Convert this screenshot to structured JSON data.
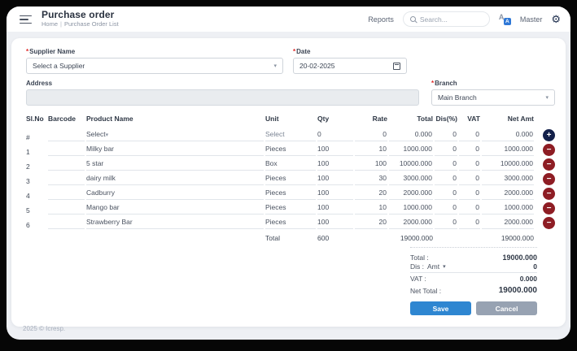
{
  "header": {
    "title": "Purchase order",
    "breadcrumb": {
      "home": "Home",
      "separator": "|",
      "current": "Purchase Order List"
    },
    "nav": {
      "reports": "Reports",
      "master": "Master"
    },
    "search": {
      "placeholder": "Search..."
    }
  },
  "icons": {
    "menu": "hamburger-bars",
    "search": "magnifier",
    "language_letter": "A",
    "gear": "⚙",
    "caret_down": "▾",
    "calendar": "calendar-box",
    "add": "+",
    "remove": "−"
  },
  "form": {
    "supplier": {
      "required_mark": "*",
      "label": "Supplier Name",
      "value": "Select a Supplier"
    },
    "date": {
      "required_mark": "*",
      "label": "Date",
      "value": "20-02-2025"
    },
    "address": {
      "label": "Address",
      "value": ""
    },
    "branch": {
      "required_mark": "*",
      "label": "Branch",
      "value": "Main Branch"
    }
  },
  "table": {
    "columns": [
      "Sl.No",
      "Barcode",
      "Product Name",
      "Unit",
      "Qty",
      "Rate",
      "Total",
      "Dis(%)",
      "VAT",
      "Net Amt"
    ],
    "entry_row": {
      "slno": "#",
      "barcode": "",
      "product": "Select",
      "unit": "Select",
      "qty": "0",
      "rate": "0",
      "total": "0.000",
      "dis": "0",
      "vat": "0",
      "net": "0.000"
    },
    "rows": [
      {
        "slno": "1",
        "barcode": "",
        "product": "Milky bar",
        "unit": "Pieces",
        "qty": "100",
        "rate": "10",
        "total": "1000.000",
        "dis": "0",
        "vat": "0",
        "net": "1000.000"
      },
      {
        "slno": "2",
        "barcode": "",
        "product": "5 star",
        "unit": "Box",
        "qty": "100",
        "rate": "100",
        "total": "10000.000",
        "dis": "0",
        "vat": "0",
        "net": "10000.000"
      },
      {
        "slno": "3",
        "barcode": "",
        "product": "dairy milk",
        "unit": "Pieces",
        "qty": "100",
        "rate": "30",
        "total": "3000.000",
        "dis": "0",
        "vat": "0",
        "net": "3000.000"
      },
      {
        "slno": "4",
        "barcode": "",
        "product": "Cadburry",
        "unit": "Pieces",
        "qty": "100",
        "rate": "20",
        "total": "2000.000",
        "dis": "0",
        "vat": "0",
        "net": "2000.000"
      },
      {
        "slno": "5",
        "barcode": "",
        "product": "Mango bar",
        "unit": "Pieces",
        "qty": "100",
        "rate": "10",
        "total": "1000.000",
        "dis": "0",
        "vat": "0",
        "net": "1000.000"
      },
      {
        "slno": "6",
        "barcode": "",
        "product": "Strawberry Bar",
        "unit": "Pieces",
        "qty": "100",
        "rate": "20",
        "total": "2000.000",
        "dis": "0",
        "vat": "0",
        "net": "2000.000"
      }
    ],
    "totals_row": {
      "label": "Total",
      "qty": "600",
      "total": "19000.000",
      "net": "19000.000"
    }
  },
  "summary": {
    "total": {
      "label": "Total :",
      "value": "19000.000"
    },
    "discount": {
      "label": "Dis :",
      "mode": "Amt",
      "value": "0"
    },
    "vat": {
      "label": "VAT :",
      "value": "0.000"
    },
    "net_total": {
      "label": "Net Total :",
      "value": "19000.000"
    },
    "save_label": "Save",
    "cancel_label": "Cancel"
  },
  "footer": {
    "copyright": "2025 © Icresp."
  },
  "colors": {
    "accent_blue": "#2e86d1",
    "cancel_gray": "#97a2b2",
    "add_navy": "#13204a",
    "remove_maroon": "#8e1d24",
    "required_red": "#e02a2a",
    "body_gray": "#eef0f4"
  }
}
